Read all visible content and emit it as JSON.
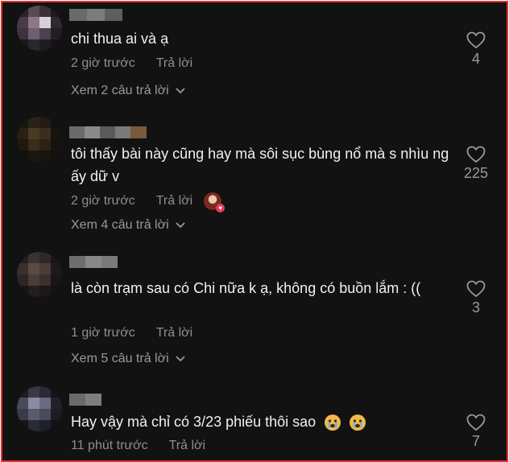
{
  "comments": [
    {
      "text": "chi thua ai và ạ",
      "time": "2 giờ trước",
      "reply_label": "Trả lời",
      "view_replies": "Xem 2 câu trả lời",
      "likes": "4"
    },
    {
      "text": "tôi thấy bài này cũng hay mà sôi sục bùng nổ mà s nhìu ng ấy dữ v",
      "time": "2 giờ trước",
      "reply_label": "Trả lời",
      "view_replies": "Xem 4 câu trả lời",
      "likes": "225",
      "creator_liked": true
    },
    {
      "text": "là còn trạm sau có Chi nữa k ạ, không có buồn lắm : ((",
      "time": "1 giờ trước",
      "reply_label": "Trả lời",
      "view_replies": "Xem 5 câu trả lời",
      "likes": "3"
    },
    {
      "text": "Hay vậy mà chỉ có 3/23 phiếu thôi sao",
      "emojis": [
        "crying-face-icon",
        "crying-face-icon"
      ],
      "time": "11 phút trước",
      "reply_label": "Trả lời",
      "likes": "7"
    }
  ],
  "colors": {
    "background": "#121212",
    "border": "#e0322e",
    "text": "#f1f1f1",
    "muted": "#8e8e8e"
  }
}
